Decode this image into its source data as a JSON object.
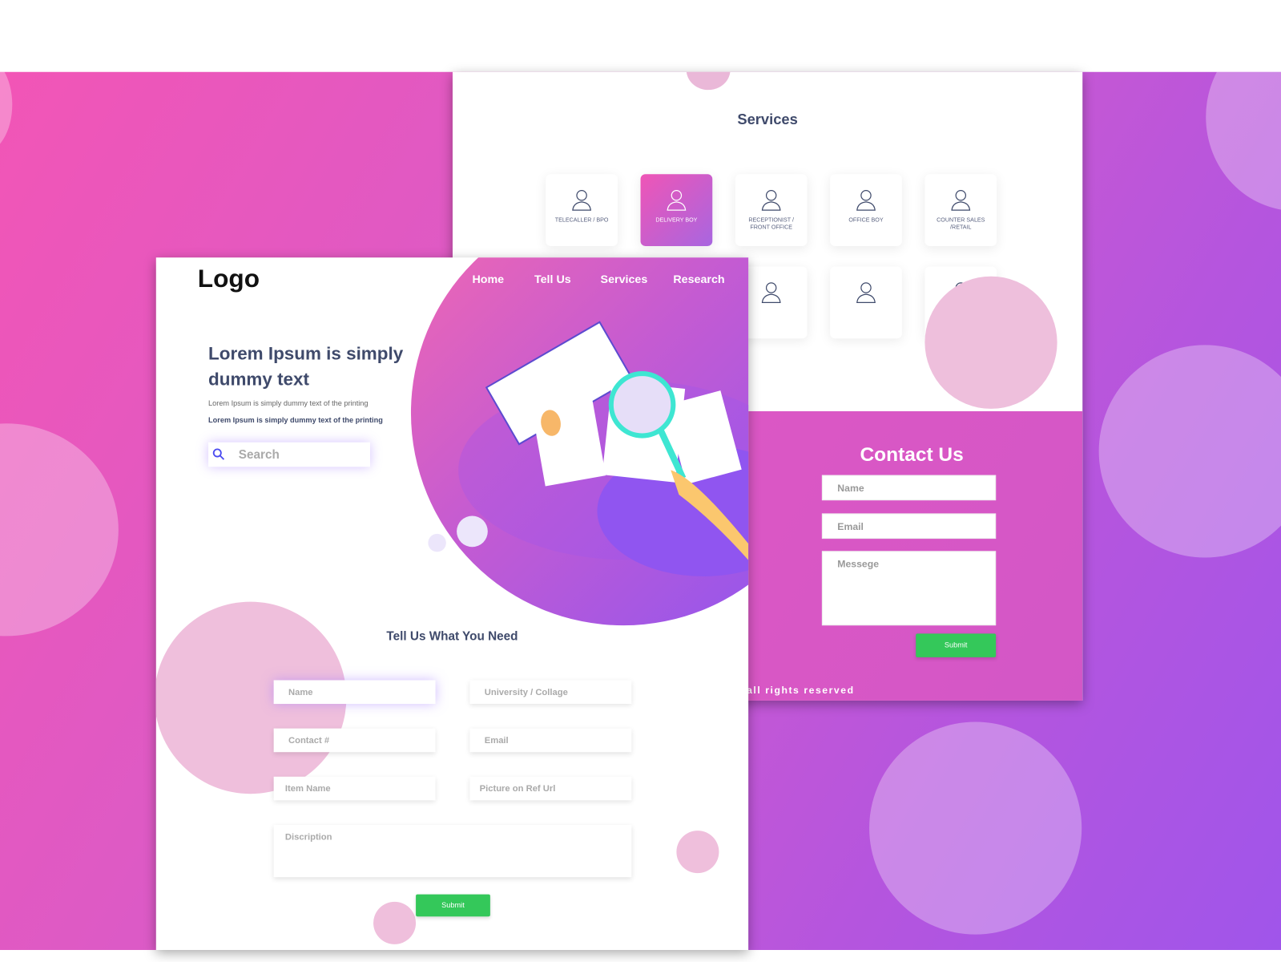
{
  "services": {
    "title": "Services",
    "cards": [
      {
        "label": "TELECALLER / BPO",
        "icon": "telecaller-icon"
      },
      {
        "label": "DELIVERY BOY",
        "icon": "delivery-boy-icon",
        "active": true
      },
      {
        "label": "RECEPTIONIST / FRONT OFFICE",
        "icon": "receptionist-icon"
      },
      {
        "label": "OFFICE BOY",
        "icon": "office-boy-icon"
      },
      {
        "label": "COUNTER SALES /RETAIL",
        "icon": "counter-sales-icon"
      }
    ]
  },
  "contact": {
    "title": "Contact Us",
    "name_placeholder": "Name",
    "email_placeholder": "Email",
    "message_placeholder": "Messege",
    "submit": "Submit",
    "footer": "all rights reserved"
  },
  "header": {
    "logo": "Logo",
    "nav": [
      "Home",
      "Tell Us",
      "Services",
      "Research"
    ]
  },
  "hero": {
    "title": "Lorem Ipsum is simply dummy text",
    "sub1": "Lorem Ipsum is simply dummy text of the printing",
    "sub2": "Lorem Ipsum is simply dummy text of the printing",
    "search_placeholder": "Search"
  },
  "form": {
    "title": "Tell Us What You Need",
    "name": "Name",
    "university": "University /  Collage",
    "contact": "Contact #",
    "email": "Email",
    "item": "Item Name",
    "picture": "Picture on Ref Url",
    "description": "Discription",
    "submit": "Submit"
  },
  "colors": {
    "accent": "#d95bc8",
    "submit": "#34c85a",
    "text": "#3f4a6b"
  }
}
